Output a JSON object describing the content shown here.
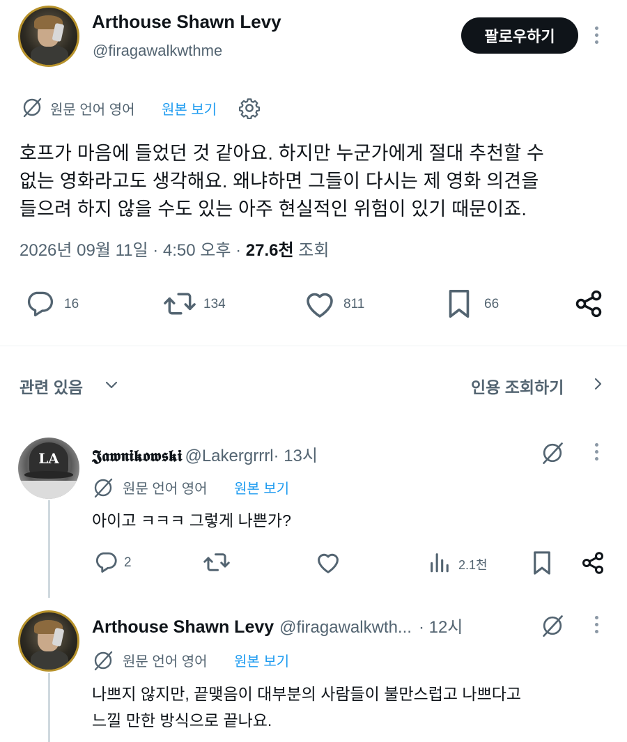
{
  "author": {
    "name": "Arthouse Shawn Levy",
    "handle": "@firagawalkwthme",
    "follow_label": "팔로우하기"
  },
  "translation": {
    "original_label": "원문 언어 영어",
    "view_original": "원본 보기"
  },
  "post": {
    "lines": [
      "호프가 마음에 들었던 것 같아요. 하지만 누군가에게 절대 추천할 수",
      "없는 영화라고도 생각해요. 왜냐하면 그들이 다시는 제 영화 의견을",
      "들으려 하지 않을 수도 있는 아주 현실적인 위험이 있기 때문이죠."
    ],
    "timestamp": "2026년 09월 11일 · 4:50 오후 · ",
    "views_count": "27.6천",
    "views_label": " 조회"
  },
  "stats": {
    "replies": "16",
    "reposts": "134",
    "likes": "811",
    "bookmarks": "66"
  },
  "related": {
    "label": "관련 있음",
    "quotes_label": "인용 조회하기"
  },
  "replies": [
    {
      "name": "𝕵𝖆𝖜𝖓𝖎𝖐𝖔𝖜𝖘𝖐𝖎",
      "handle": "@Lakergrrrl",
      "time": " · 13시",
      "avatar_text": "LA",
      "translation_label": "원문 언어 영어",
      "view_original": "원본 보기",
      "text": "아이고 ㅋㅋㅋ 그렇게 나쁜가?",
      "reply_count": "2",
      "views": "2.1천"
    },
    {
      "name": "Arthouse Shawn Levy",
      "handle": "@firagawalkwth...",
      "time": " · 12시",
      "translation_label": "원문 언어 영어",
      "view_original": "원본 보기",
      "lines": [
        "나쁘지 않지만, 끝맺음이 대부분의 사람들이 불만스럽고 나쁘다고",
        "느낄 만한 방식으로 끝나요."
      ]
    }
  ],
  "colors": {
    "text": "#0f1419",
    "secondary": "#536471",
    "link": "#1d9bf0",
    "avatar_ring": "#b7922b"
  },
  "icons": [
    "translate-icon",
    "settings-gear-icon",
    "reply-icon",
    "repost-icon",
    "like-icon",
    "bookmark-icon",
    "share-icon",
    "chevron-down-icon",
    "chevron-right-icon",
    "grok-icon",
    "more-icon",
    "views-icon"
  ]
}
